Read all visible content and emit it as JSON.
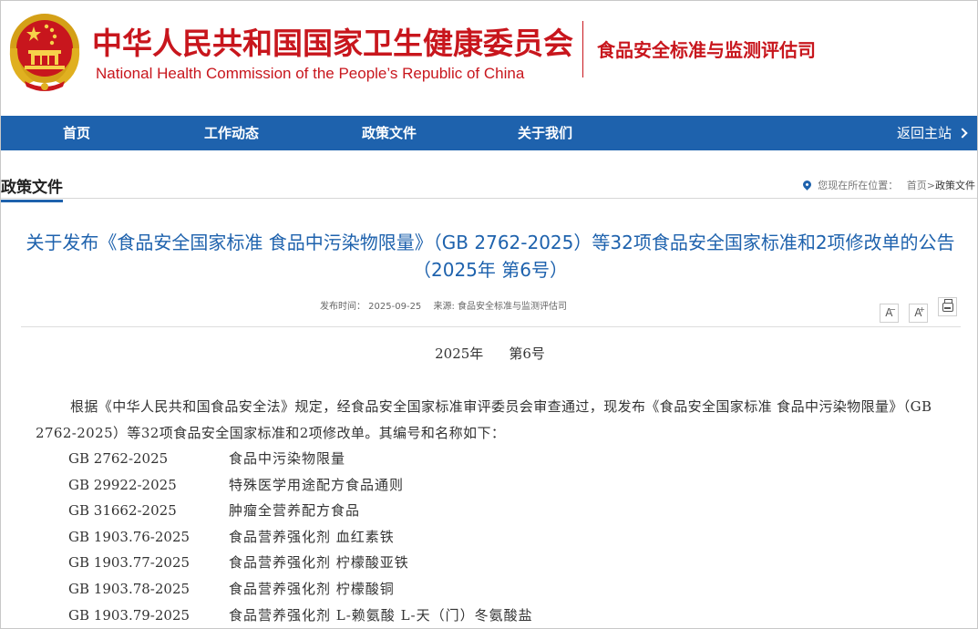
{
  "header": {
    "org_cn": "中华人民共和国国家卫生健康委员会",
    "org_en": "National Health Commission of the People’s  Republic of China",
    "department": "食品安全标准与监测评估司"
  },
  "nav": {
    "items": [
      {
        "label": "首页"
      },
      {
        "label": "工作动态"
      },
      {
        "label": "政策文件"
      },
      {
        "label": "关于我们"
      }
    ],
    "back_label": "返回主站"
  },
  "section": {
    "title": "政策文件",
    "breadcrumb_prefix": "您现在所在位置：",
    "breadcrumb_home": "首页",
    "breadcrumb_sep": ">",
    "breadcrumb_current": "政策文件"
  },
  "article": {
    "title": "关于发布《食品安全国家标准 食品中污染物限量》（GB 2762-2025）等32项食品安全国家标准和2项修改单的公告（2025年 第6号）",
    "publish_time": "发布时间：   2025-09-25",
    "source": "来源: 食品安全标准与监测评估司",
    "tools": {
      "font_smaller": "A",
      "font_larger": "A"
    },
    "doc_year": "2025年",
    "doc_no": "第6号",
    "paragraph": "根据《中华人民共和国食品安全法》规定，经食品安全国家标准审评委员会审查通过，现发布《食品安全国家标准 食品中污染物限量》（GB 2762-2025）等32项食品安全国家标准和2项修改单。其编号和名称如下：",
    "standards": [
      {
        "code": "GB 2762-2025",
        "name": "食品中污染物限量"
      },
      {
        "code": "GB 29922-2025",
        "name": "特殊医学用途配方食品通则"
      },
      {
        "code": "GB 31662-2025",
        "name": "肿瘤全营养配方食品"
      },
      {
        "code": "GB 1903.76-2025",
        "name": "食品营养强化剂 血红素铁"
      },
      {
        "code": "GB 1903.77-2025",
        "name": "食品营养强化剂 柠檬酸亚铁"
      },
      {
        "code": "GB 1903.78-2025",
        "name": "食品营养强化剂 柠檬酸铜"
      },
      {
        "code": "GB 1903.79-2025",
        "name": "食品营养强化剂 L-赖氨酸 L-天（门）冬氨酸盐"
      }
    ]
  },
  "colors": {
    "brand_red": "#c8161d",
    "nav_blue": "#1e62ad",
    "title_blue": "#1e62ad"
  },
  "icons": {
    "emblem": "national-emblem",
    "location": "location-pin-icon",
    "print": "printer-icon"
  }
}
